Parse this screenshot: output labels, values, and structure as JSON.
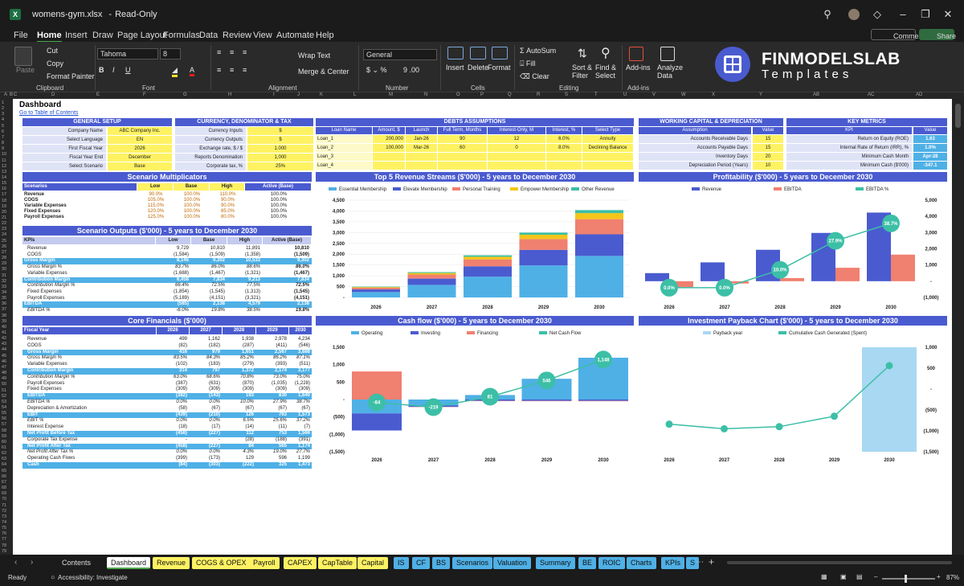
{
  "titlebar": {
    "file": "womens-gym.xlsx",
    "mode": "Read-Only"
  },
  "menu": [
    "File",
    "Home",
    "Insert",
    "Draw",
    "Page Layout",
    "Formulas",
    "Data",
    "Review",
    "View",
    "Automate",
    "Help"
  ],
  "ribbon": {
    "comments": "Comments",
    "share": "Share",
    "paste": "Paste",
    "cut": "Cut",
    "copy": "Copy",
    "format_painter": "Format Painter",
    "clipboard": "Clipboard",
    "font_name": "Tahoma",
    "font_size": "8",
    "font": "Font",
    "wrap": "Wrap Text",
    "merge": "Merge & Center",
    "alignment": "Alignment",
    "number_format": "General",
    "number": "Number",
    "insert": "Insert",
    "delete": "Delete",
    "format": "Format",
    "cells": "Cells",
    "autosum": "AutoSum",
    "fill": "Fill",
    "clear": "Clear",
    "sort": "Sort & Filter",
    "find": "Find & Select",
    "editing": "Editing",
    "addins": "Add-ins",
    "analyze": "Analyze Data",
    "addins_grp": "Add-ins"
  },
  "logo": {
    "line1": "FINMODELSLAB",
    "line2": "Templates"
  },
  "sheet": {
    "title": "Dashboard",
    "link": "Go to Table of Contents"
  },
  "general_setup": {
    "title": "GENERAL SETUP",
    "rows": [
      [
        "Company Name",
        "ABC Company Inc."
      ],
      [
        "Select Language",
        "EN"
      ],
      [
        "First Fiscal Year",
        "2026"
      ],
      [
        "Fiscal Year End",
        "December"
      ],
      [
        "Select Scenario",
        "Base"
      ]
    ]
  },
  "currency": {
    "title": "CURRENCY, DENOMINATOR & TAX",
    "rows": [
      [
        "Currency Inputs",
        "$"
      ],
      [
        "Currency Outputs",
        "$"
      ],
      [
        "Exchange rate, $ / $",
        "1.000"
      ],
      [
        "Reports Denomination",
        "1,000"
      ],
      [
        "Corporate tax, %",
        "25%"
      ]
    ]
  },
  "debts": {
    "title": "DEBTS ASSUMPTIONS",
    "headers": [
      "Loan Name",
      "Amount, $",
      "Launch",
      "Full Term, Months",
      "Interest-Only, M",
      "Interest, %",
      "Select Type"
    ],
    "rows": [
      [
        "Loan_1",
        "200,000",
        "Jan-26",
        "90",
        "12",
        "6.0%",
        "Annuity"
      ],
      [
        "Loan_2",
        "100,000",
        "Mar-26",
        "60",
        "0",
        "8.0%",
        "Declining Balance"
      ],
      [
        "Loan_3",
        "",
        "",
        "",
        "",
        "",
        ""
      ],
      [
        "Loan_4",
        "",
        "",
        "",
        "",
        "",
        ""
      ]
    ]
  },
  "working_capital": {
    "title": "WORKING CAPITAL & DEPRECIATION",
    "headers": [
      "Assumption",
      "Value"
    ],
    "rows": [
      [
        "Accounts Receivable Days",
        "15"
      ],
      [
        "Accounts Payable Days",
        "15"
      ],
      [
        "Inventory Days",
        "20"
      ],
      [
        "Depreciation Period (Years)",
        "10"
      ]
    ]
  },
  "key_metrics": {
    "title": "KEY METRICS",
    "headers": [
      "KPI",
      "Value"
    ],
    "rows": [
      [
        "Return on Equity (ROE)",
        "1.63"
      ],
      [
        "Internal Rate of Return (IRR), %",
        "1.0%"
      ],
      [
        "Minimum Cash Month",
        "Apr-28"
      ],
      [
        "Minimum Cash ($'000)",
        "-347.1"
      ]
    ]
  },
  "multipliers": {
    "title": "Scenario Multiplicators",
    "headers": [
      "Scenarios",
      "Low",
      "Base",
      "High",
      "Active (Base)"
    ],
    "rows": [
      [
        "Revenue",
        "90.0%",
        "100.0%",
        "110.0%",
        "100.0%"
      ],
      [
        "COGS",
        "105.0%",
        "100.0%",
        "90.0%",
        "100.0%"
      ],
      [
        "Variable Expenses",
        "115.0%",
        "100.0%",
        "90.0%",
        "100.0%"
      ],
      [
        "Fixed Expenses",
        "120.0%",
        "100.0%",
        "85.0%",
        "100.0%"
      ],
      [
        "Payroll Expenses",
        "125.0%",
        "100.0%",
        "80.0%",
        "100.0%"
      ]
    ]
  },
  "scenario_outputs": {
    "title": "Scenario Outputs ($'000) - 5 years to December 2030",
    "headers": [
      "KPIs",
      "Low",
      "Base",
      "High",
      "Active (Base)"
    ],
    "rows": [
      [
        "Revenue",
        "9,729",
        "10,810",
        "11,891",
        "10,810",
        ""
      ],
      [
        "COGS",
        "(1,584)",
        "(1,509)",
        "(1,358)",
        "(1,509)",
        ""
      ],
      [
        "Gross Margin",
        "8,145",
        "9,302",
        "10,533",
        "9,302",
        "band"
      ],
      [
        "Gross Margin %",
        "83.7%",
        "86.0%",
        "88.6%",
        "86.0%",
        "it"
      ],
      [
        "Variable Expenses",
        "(1,688)",
        "(1,467)",
        "(1,321)",
        "(1,467)",
        ""
      ],
      [
        "Contribution Margin",
        "6,458",
        "7,834",
        "9,213",
        "7,834",
        "band"
      ],
      [
        "Contribution Margin %",
        "66.4%",
        "72.5%",
        "77.5%",
        "72.5%",
        "it"
      ],
      [
        "Fixed Expenses",
        "(1,854)",
        "(1,545)",
        "(1,313)",
        "(1,545)",
        ""
      ],
      [
        "Payroll Expenses",
        "(5,189)",
        "(4,151)",
        "(3,321)",
        "(4,151)",
        ""
      ],
      [
        "EBITDA",
        "(585)",
        "2,138",
        "4,579",
        "2,138",
        "band"
      ],
      [
        "EBITDA %",
        "-6.0%",
        "19.8%",
        "38.5%",
        "19.8%",
        "it"
      ]
    ]
  },
  "core": {
    "title": "Core Financials ($'000)",
    "headers": [
      "Fiscal Year",
      "2026",
      "2027",
      "2028",
      "2029",
      "2030"
    ],
    "rows": [
      [
        "Revenue",
        "499",
        "1,162",
        "1,938",
        "2,978",
        "4,234",
        ""
      ],
      [
        "COGS",
        "(82)",
        "(182)",
        "(287)",
        "(411)",
        "(546)",
        ""
      ],
      [
        "Gross Margin",
        "416",
        "979",
        "1,651",
        "2,567",
        "3,688",
        "band"
      ],
      [
        "Gross Margin %",
        "83.5%",
        "84.3%",
        "85.2%",
        "86.2%",
        "87.1%",
        "it"
      ],
      [
        "Variable Expenses",
        "(102)",
        "(183)",
        "(279)",
        "(393)",
        "(511)",
        ""
      ],
      [
        "Contribution Margin",
        "314",
        "797",
        "1,372",
        "2,174",
        "3,177",
        "band"
      ],
      [
        "Contribution Margin %",
        "63.0%",
        "68.6%",
        "70.8%",
        "73.0%",
        "75.0%",
        "it"
      ],
      [
        "Payroll Expenses",
        "(387)",
        "(631)",
        "(870)",
        "(1,035)",
        "(1,228)",
        ""
      ],
      [
        "Fixed Expenses",
        "(309)",
        "(309)",
        "(309)",
        "(309)",
        "(309)",
        ""
      ],
      [
        "EBITDA",
        "(382)",
        "(143)",
        "193",
        "830",
        "1,640",
        "band"
      ],
      [
        "EBITDA %",
        "0.0%",
        "0.0%",
        "10.0%",
        "27.9%",
        "38.7%",
        "it"
      ],
      [
        "Depreciation & Amortization",
        "(58)",
        "(67)",
        "(67)",
        "(67)",
        "(67)",
        ""
      ],
      [
        "EBIT",
        "(439)",
        "(210)",
        "126",
        "763",
        "1,573",
        "band"
      ],
      [
        "EBIT %",
        "0.0%",
        "0.0%",
        "6.5%",
        "25.6%",
        "37.2%",
        "it"
      ],
      [
        "Interest Expense",
        "(18)",
        "(17)",
        "(14)",
        "(11)",
        "(7)",
        ""
      ],
      [
        "Net Profit Before Tax",
        "(458)",
        "(227)",
        "112",
        "753",
        "1,566",
        "band"
      ],
      [
        "Corporate Tax Expense",
        "-",
        "-",
        "(28)",
        "(188)",
        "(391)",
        ""
      ],
      [
        "Net Profit After Tax",
        "(458)",
        "(227)",
        "84",
        "565",
        "1,174",
        "band"
      ],
      [
        "Net Profit After Tax %",
        "0.0%",
        "0.0%",
        "4.3%",
        "19.0%",
        "27.7%",
        "it"
      ],
      [
        "Operating Cash Flows",
        "(399)",
        "(173)",
        "129",
        "596",
        "1,199",
        ""
      ],
      [
        "Cash",
        "(84)",
        "(303)",
        "(222)",
        "325",
        "1,473",
        "band"
      ]
    ]
  },
  "chart_data": [
    {
      "type": "bar",
      "title": "Top 5 Revenue Streams ($'000) - 5 years to December 2030",
      "categories": [
        "2026",
        "2027",
        "2028",
        "2029",
        "2030"
      ],
      "series": [
        {
          "name": "Essential Membership",
          "color": "#4fb0e6",
          "values": [
            250,
            580,
            960,
            1480,
            1920
          ]
        },
        {
          "name": "Elevate Membership",
          "color": "#4a5bd0",
          "values": [
            120,
            290,
            480,
            720,
            1000
          ]
        },
        {
          "name": "Personal Training",
          "color": "#f08070",
          "values": [
            80,
            190,
            320,
            500,
            700
          ]
        },
        {
          "name": "Empower Membership",
          "color": "#f5c518",
          "values": [
            30,
            70,
            120,
            200,
            280
          ]
        },
        {
          "name": "Other Revenue",
          "color": "#3cbfa6",
          "values": [
            20,
            40,
            70,
            100,
            140
          ]
        }
      ],
      "ylim": [
        0,
        4500
      ],
      "yticks": [
        "4,500",
        "4,000",
        "3,500",
        "3,000",
        "2,500",
        "2,000",
        "1,500",
        "1,000",
        "500",
        "-"
      ]
    },
    {
      "type": "bar",
      "title": "Profitability ($'000) - 5 years to December 2030",
      "categories": [
        "2026",
        "2027",
        "2028",
        "2029",
        "2030"
      ],
      "series": [
        {
          "name": "Revenue",
          "color": "#4a5bd0",
          "values": [
            499,
            1162,
            1938,
            2978,
            4234
          ]
        },
        {
          "name": "EBITDA",
          "color": "#f08070",
          "values": [
            -382,
            -143,
            193,
            830,
            1640
          ]
        },
        {
          "name": "EBITDA %",
          "color": "#3cbfa6",
          "values": [
            0.0,
            0.0,
            10.0,
            27.9,
            38.7
          ]
        }
      ],
      "ylim": [
        -1000,
        5000
      ],
      "yticks": [
        "5,000",
        "4,000",
        "3,000",
        "2,000",
        "1,000",
        "-",
        "(1,000)"
      ]
    },
    {
      "type": "bar",
      "title": "Cash flow ($'000) - 5 years to December 2030",
      "categories": [
        "2026",
        "2027",
        "2028",
        "2029",
        "2030"
      ],
      "series": [
        {
          "name": "Operating",
          "color": "#4fb0e6",
          "values": [
            -399,
            -173,
            129,
            596,
            1199
          ]
        },
        {
          "name": "Investing",
          "color": "#4a5bd0",
          "values": [
            -490,
            -40,
            -40,
            -40,
            -40
          ]
        },
        {
          "name": "Financing",
          "color": "#f08070",
          "values": [
            805,
            -6,
            -8,
            -10,
            -11
          ]
        },
        {
          "name": "Net Cash Flow",
          "color": "#3cbfa6",
          "values": [
            -84,
            -219,
            81,
            546,
            1148
          ]
        }
      ],
      "ylim": [
        -1500,
        1500
      ],
      "yticks": [
        "1,500",
        "1,000",
        "500",
        "-",
        "(500)",
        "(1,000)",
        "(1,500)"
      ]
    },
    {
      "type": "line",
      "title": "Investment Payback Chart ($'000) - 5 years to December 2030",
      "categories": [
        "2026",
        "2027",
        "2028",
        "2029",
        "2030"
      ],
      "series": [
        {
          "name": "Payback year",
          "color": "#a8d8f2",
          "values": [
            0,
            0,
            0,
            0,
            1
          ]
        },
        {
          "name": "Cumulative Cash Generated (Spent)",
          "color": "#3cbfa6",
          "values": [
            -840,
            -950,
            -900,
            -650,
            560
          ]
        }
      ],
      "ylim": [
        -1500,
        1000
      ],
      "yticks": [
        "1,000",
        "500",
        "-",
        "(500)",
        "(1,000)",
        "(1,500)"
      ]
    }
  ],
  "tabs": [
    {
      "label": "Contents",
      "bg": "none"
    },
    {
      "label": "Dashboard",
      "bg": "active"
    },
    {
      "label": "Revenue",
      "bg": "#fef263"
    },
    {
      "label": "COGS & OPEX",
      "bg": "#fef263"
    },
    {
      "label": "Payroll",
      "bg": "#fef263"
    },
    {
      "label": "CAPEX",
      "bg": "#fef263"
    },
    {
      "label": "CapTable",
      "bg": "#fef263"
    },
    {
      "label": "Capital",
      "bg": "#fef263"
    },
    {
      "label": "IS",
      "bg": "#4fb0e6"
    },
    {
      "label": "CF",
      "bg": "#4fb0e6"
    },
    {
      "label": "BS",
      "bg": "#4fb0e6"
    },
    {
      "label": "Scenarios",
      "bg": "#4fb0e6"
    },
    {
      "label": "Valuation",
      "bg": "#4fb0e6"
    },
    {
      "label": "Summary",
      "bg": "#4fb0e6"
    },
    {
      "label": "BE",
      "bg": "#4fb0e6"
    },
    {
      "label": "ROIC",
      "bg": "#4fb0e6"
    },
    {
      "label": "Charts",
      "bg": "#4fb0e6"
    },
    {
      "label": "KPIs",
      "bg": "#4fb0e6"
    },
    {
      "label": "S",
      "bg": "#4fb0e6"
    }
  ],
  "status": {
    "ready": "Ready",
    "accessibility": "Accessibility: Investigate",
    "zoom": "87%"
  }
}
